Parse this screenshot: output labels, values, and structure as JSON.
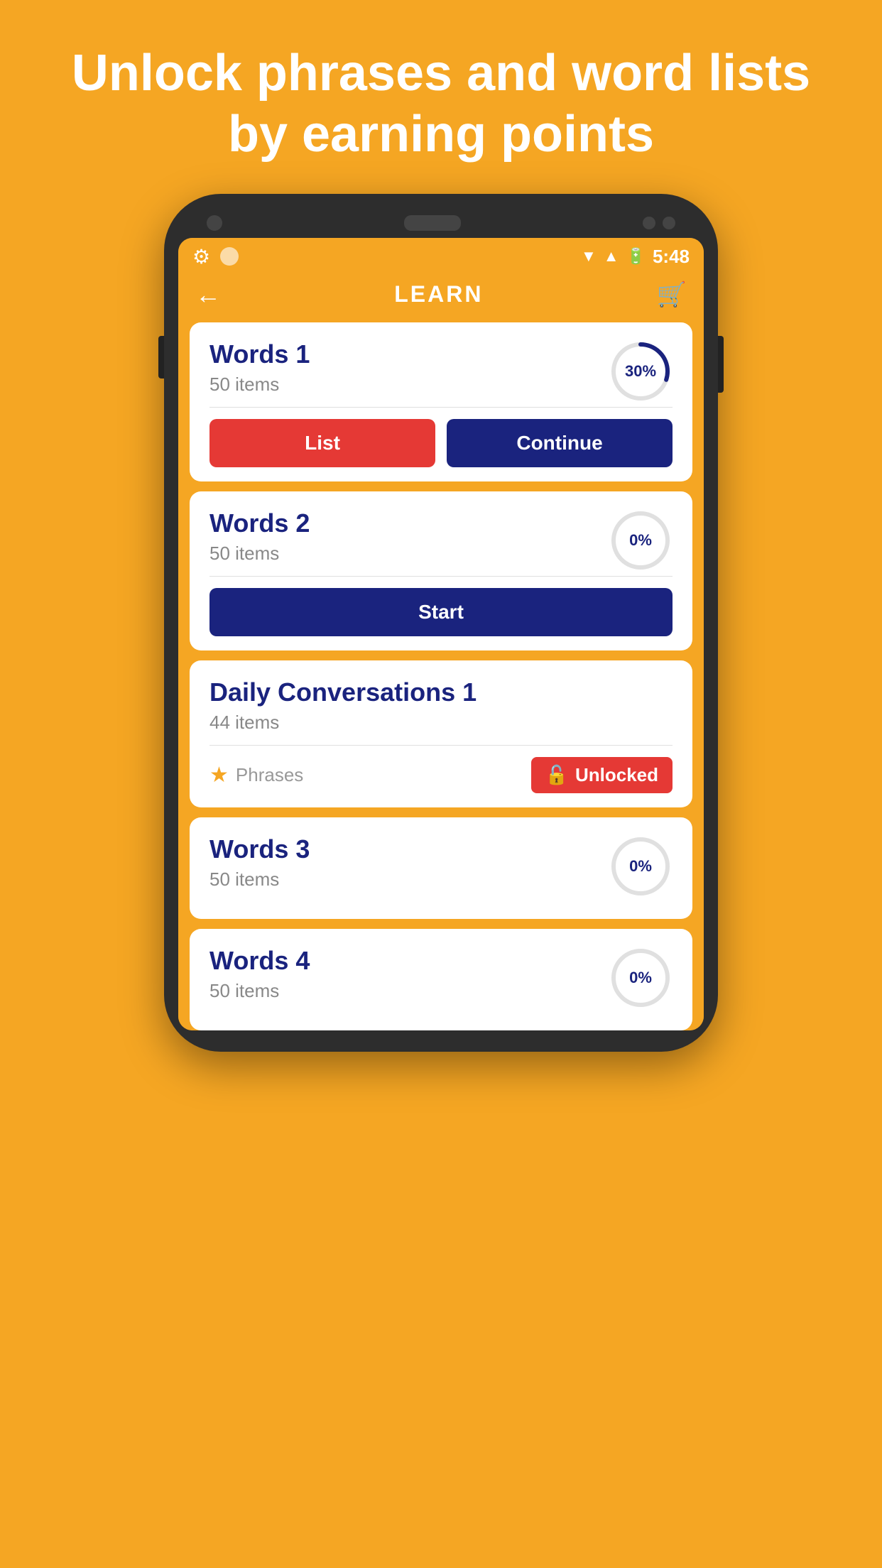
{
  "hero": {
    "text": "Unlock phrases and word lists by earning points"
  },
  "status_bar": {
    "time": "5:48"
  },
  "header": {
    "title": "LEARN",
    "back_label": "←",
    "cart_label": "🛒"
  },
  "cards": [
    {
      "id": "words1",
      "title": "Words 1",
      "subtitle": "50 items",
      "progress": 30,
      "progress_label": "30%",
      "type": "continue",
      "btn_list": "List",
      "btn_continue": "Continue"
    },
    {
      "id": "words2",
      "title": "Words 2",
      "subtitle": "50 items",
      "progress": 0,
      "progress_label": "0%",
      "type": "start",
      "btn_start": "Start"
    },
    {
      "id": "daily-conversations1",
      "title": "Daily Conversations 1",
      "subtitle": "44 items",
      "type": "unlocked",
      "phrases_label": "Phrases",
      "unlocked_label": "Unlocked"
    },
    {
      "id": "words3",
      "title": "Words 3",
      "subtitle": "50 items",
      "progress": 0,
      "progress_label": "0%",
      "type": "progress-only"
    },
    {
      "id": "words4",
      "title": "Words 4",
      "subtitle": "50 items",
      "progress": 0,
      "progress_label": "0%",
      "type": "progress-only"
    }
  ]
}
